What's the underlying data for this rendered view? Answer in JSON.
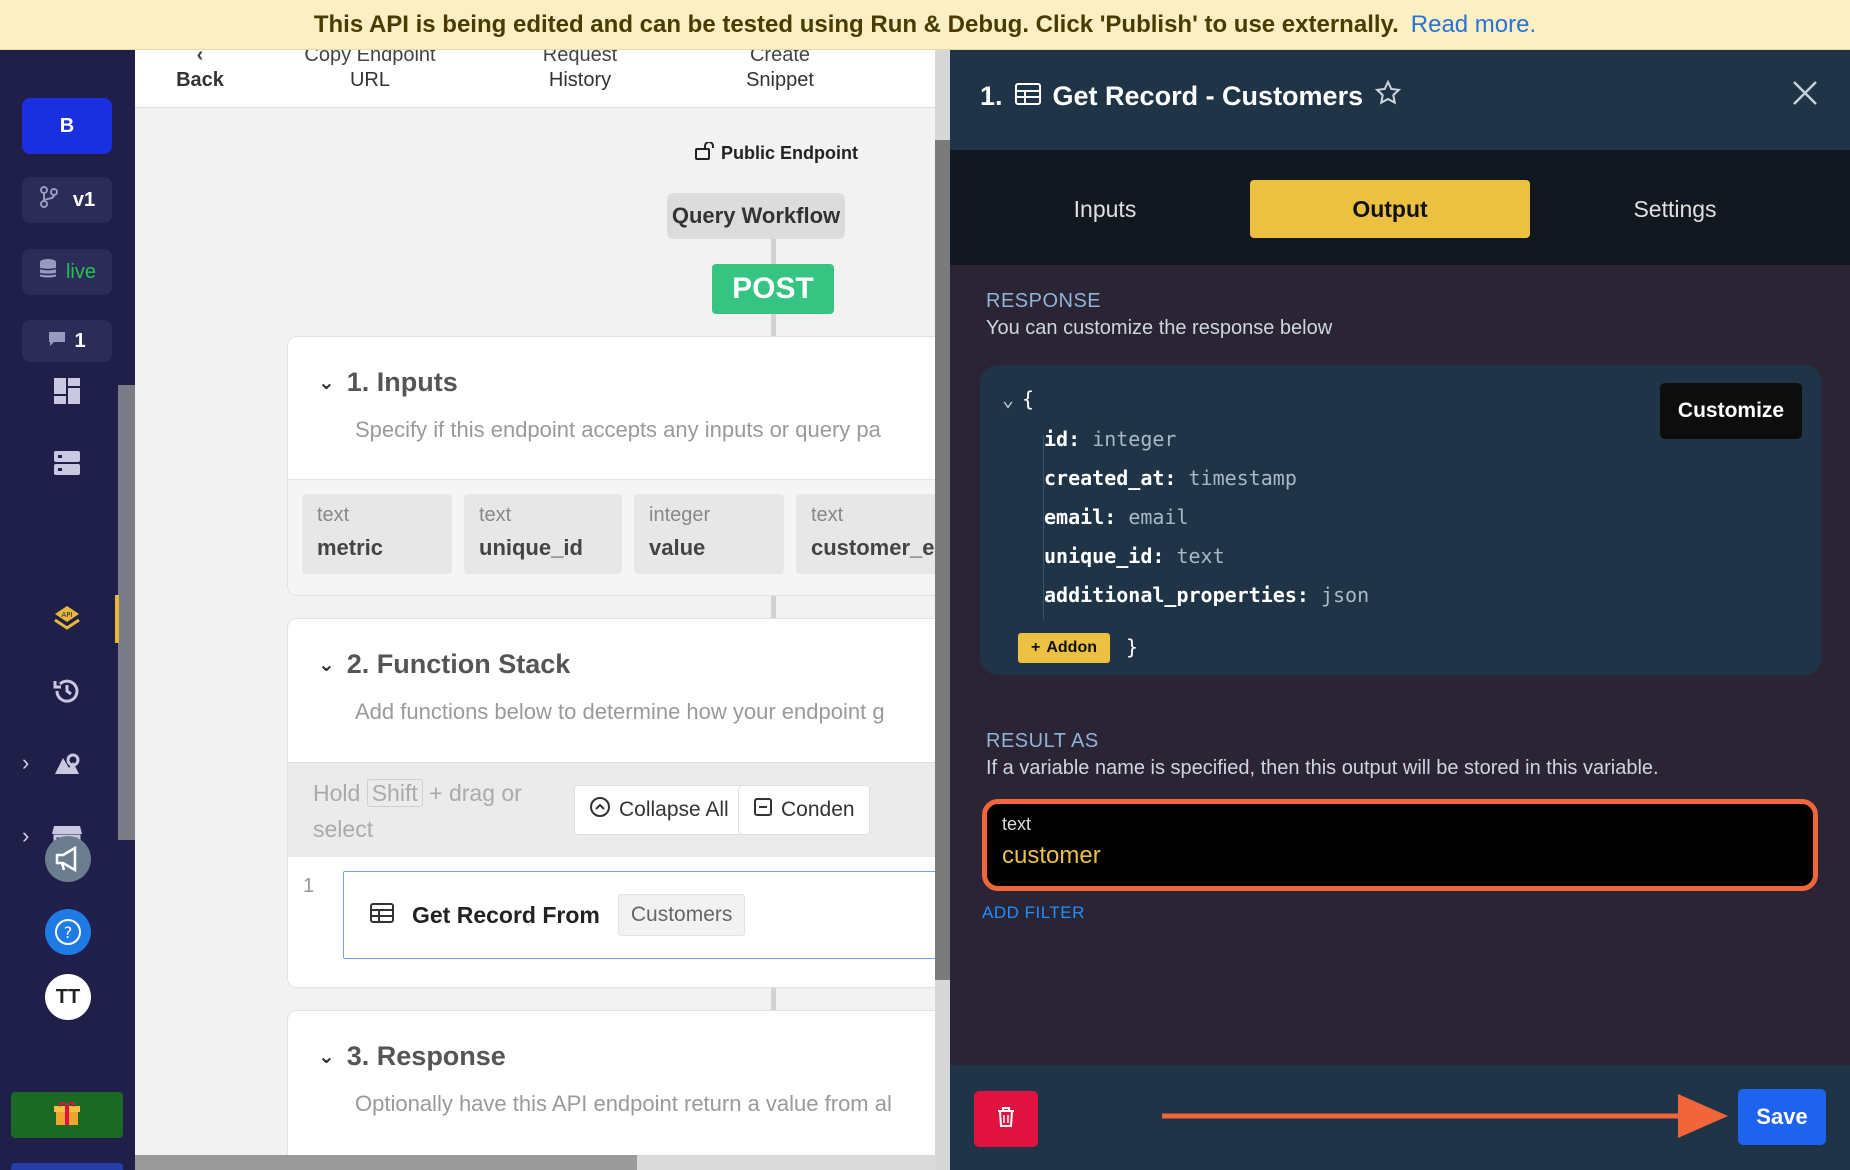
{
  "banner": {
    "message": "This API is being edited and can be tested using Run & Debug. Click 'Publish' to use externally.",
    "link": "Read more."
  },
  "sidebar": {
    "workspace_initial": "B",
    "branch_label": "v1",
    "datasource_label": "live",
    "comment_count": "1",
    "avatar_initials": "TT"
  },
  "toolbar": {
    "back": "Back",
    "copy_url_line1": "Copy Endpoint",
    "copy_url_line2": "URL",
    "history_line1": "Request",
    "history_line2": "History",
    "snippet_line1": "Create",
    "snippet_line2": "Snippet"
  },
  "canvas": {
    "public_endpoint": "Public Endpoint",
    "query_workflow": "Query Workflow",
    "method": "POST",
    "inputs_title": "1. Inputs",
    "inputs_desc": "Specify if this endpoint accepts any inputs or query pa",
    "inputs": [
      {
        "type": "text",
        "name": "metric"
      },
      {
        "type": "text",
        "name": "unique_id"
      },
      {
        "type": "integer",
        "name": "value"
      },
      {
        "type": "text",
        "name": "customer_e"
      }
    ],
    "function_stack_title": "2. Function Stack",
    "function_stack_desc": "Add functions below to determine how your endpoint g",
    "hold_prefix": "Hold",
    "hold_key": "Shift",
    "hold_suffix": "+ drag or",
    "hold_line2": "select",
    "collapse_all": "Collapse All",
    "condense": "Conden",
    "step_number": "1",
    "step_label": "Get Record From",
    "step_table": "Customers",
    "response_title": "3. Response",
    "response_desc": "Optionally have this API endpoint return a value from al"
  },
  "panel": {
    "step_index": "1.",
    "title": "Get Record - Customers",
    "tabs": [
      {
        "label": "Inputs",
        "active": false
      },
      {
        "label": "Output",
        "active": true
      },
      {
        "label": "Settings",
        "active": false
      }
    ],
    "response_label": "RESPONSE",
    "response_help": "You can customize the response below",
    "customize_label": "Customize",
    "open_brace": "{",
    "close_brace": "}",
    "fields": [
      {
        "key": "id",
        "type": "integer"
      },
      {
        "key": "created_at",
        "type": "timestamp"
      },
      {
        "key": "email",
        "type": "email"
      },
      {
        "key": "unique_id",
        "type": "text"
      },
      {
        "key": "additional_properties",
        "type": "json"
      }
    ],
    "addon_label": "Addon",
    "result_label": "RESULT AS",
    "result_help": "If a variable name is specified, then this output will be stored in this variable.",
    "variable_type": "text",
    "variable_name": "customer",
    "add_filter": "ADD FILTER",
    "save_label": "Save"
  },
  "colors": {
    "accent_yellow": "#ecc142",
    "highlight_orange": "#f0663a",
    "save_blue": "#1e63f0",
    "delete_red": "#e0123f",
    "post_green": "#35c482"
  }
}
